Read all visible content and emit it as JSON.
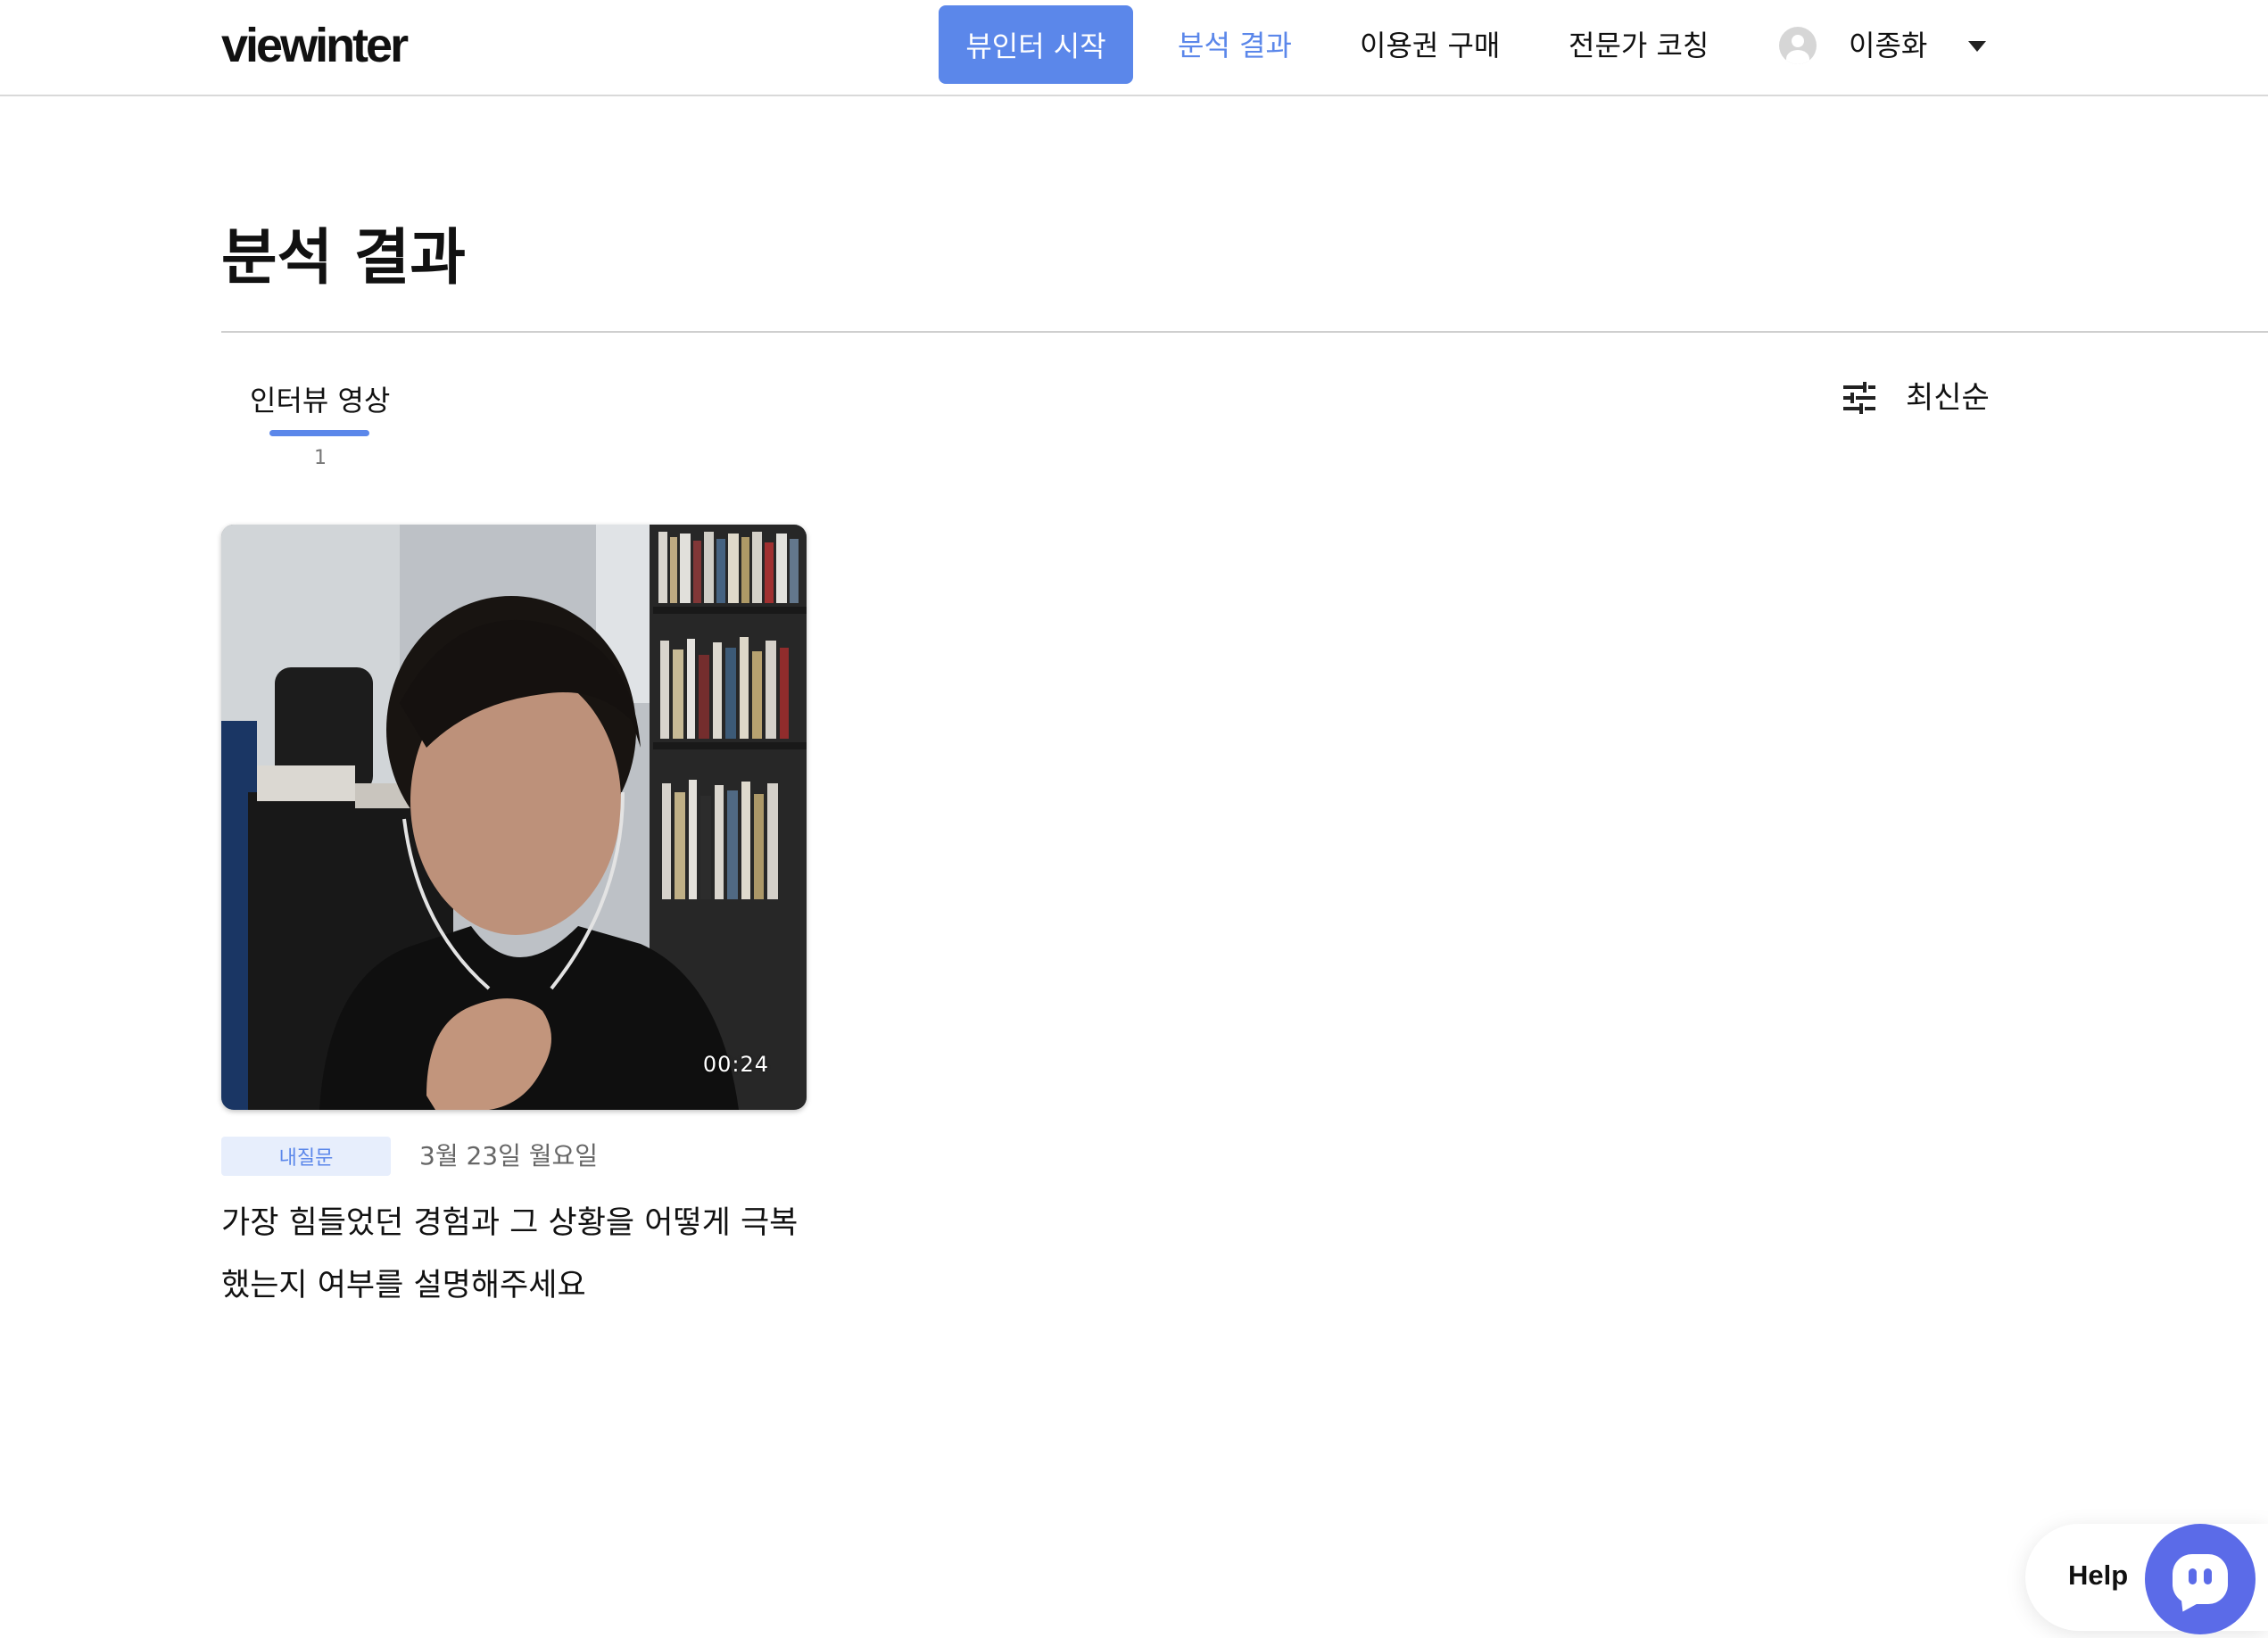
{
  "header": {
    "logo": "viewinter",
    "nav": {
      "start_label": "뷰인터 시작",
      "results_label": "분석 결과",
      "purchase_label": "이용권 구매",
      "coaching_label": "전문가 코칭"
    },
    "user": {
      "name": "이종화"
    }
  },
  "main": {
    "title": "분석 결과",
    "tab": {
      "label": "인터뷰 영상",
      "count": "1"
    },
    "sort": {
      "label": "최신순",
      "icon": "sliders-icon"
    },
    "cards": [
      {
        "duration": "00:24",
        "badge": "내질문",
        "date": "3월 23일 월요일",
        "question": "가장 힘들었던 경험과 그 상황을 어떻게 극복했는지 여부를 설명해주세요"
      }
    ]
  },
  "help": {
    "label": "Help",
    "icon": "chat-bubble-icon"
  },
  "colors": {
    "accent": "#5b87ea",
    "help_button": "#5b6be8",
    "badge_bg": "#e7eefc"
  }
}
